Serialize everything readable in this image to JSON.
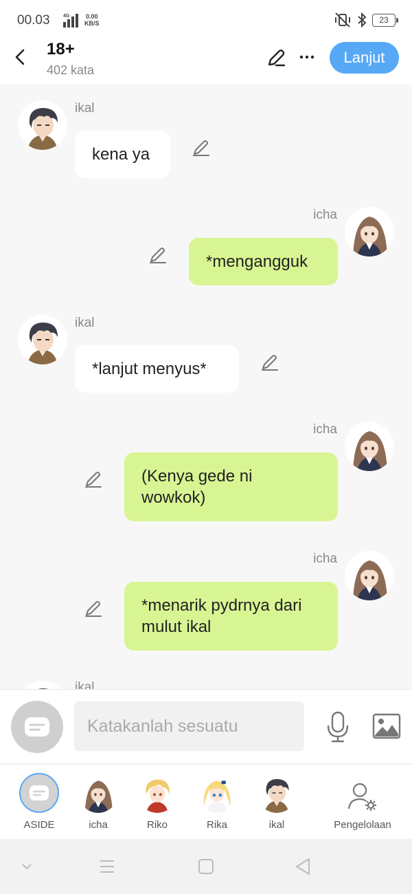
{
  "status_bar": {
    "time": "00.03",
    "network": "4G",
    "speed_value": "0.00",
    "speed_unit": "KB/S",
    "battery": "23"
  },
  "header": {
    "title": "18+",
    "subtitle": "402 kata",
    "next_label": "Lanjut"
  },
  "messages": [
    {
      "sender": "ikal",
      "side": "left",
      "text": "kena ya"
    },
    {
      "sender": "icha",
      "side": "right",
      "text": "*mengangguk"
    },
    {
      "sender": "ikal",
      "side": "left",
      "text": "*lanjut menyus*"
    },
    {
      "sender": "icha",
      "side": "right",
      "text": "(Kenya gede ni wowkok)"
    },
    {
      "sender": "icha",
      "side": "right",
      "text": "*menarik pydrnya dari mulut ikal"
    },
    {
      "sender": "ikal",
      "side": "left",
      "text": ""
    }
  ],
  "input": {
    "placeholder": "Katakanlah sesuatu"
  },
  "characters": [
    {
      "label": "ASIDE"
    },
    {
      "label": "icha"
    },
    {
      "label": "Riko"
    },
    {
      "label": "Rika"
    },
    {
      "label": "ikal"
    },
    {
      "label": "Pengelolaan"
    }
  ],
  "icons": {
    "back": "chevron-left-icon",
    "edit": "pencil-icon",
    "more": "more-horizontal-icon",
    "mic": "microphone-icon",
    "image": "image-icon",
    "manage": "user-settings-icon"
  },
  "colors": {
    "accent": "#57a8f5",
    "bubble_right": "#d8f593",
    "bubble_left": "#ffffff",
    "background": "#f7f7f7"
  }
}
